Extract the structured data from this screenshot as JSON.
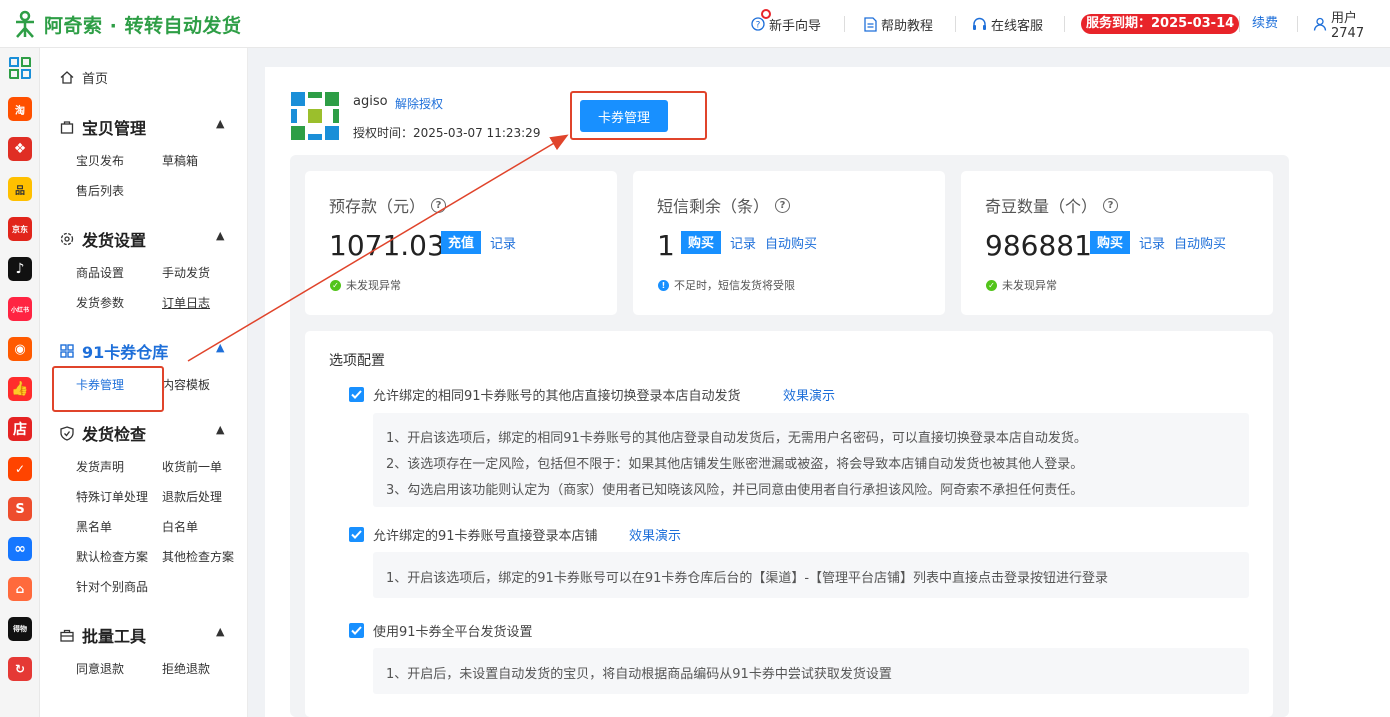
{
  "header": {
    "app_title": "阿奇索 · 转转自动发货",
    "nav": [
      {
        "label": "新手向导"
      },
      {
        "label": "帮助教程"
      },
      {
        "label": "在线客服"
      }
    ],
    "service_expiry": "服务到期：2025-03-14",
    "renew": "续费",
    "user": "用户2747"
  },
  "rail": [
    {
      "icon": "qr-grid-icon",
      "text": ""
    },
    {
      "icon": "taobao-icon",
      "text": "淘",
      "color": "#ff5000"
    },
    {
      "icon": "pinduoduo-icon",
      "text": "",
      "color": "#e02e24"
    },
    {
      "icon": "fupin-icon",
      "text": "品",
      "color": "#ffc000"
    },
    {
      "icon": "jd-icon",
      "text": "京东",
      "color": "#e1251b"
    },
    {
      "icon": "douyin-icon",
      "text": "♪",
      "color": "#111111"
    },
    {
      "icon": "xiaohongshu-icon",
      "text": "小红书",
      "color": "#ff2442"
    },
    {
      "icon": "kuaishou-icon",
      "text": "",
      "color": "#ff5a00"
    },
    {
      "icon": "thumb-icon",
      "text": "",
      "color": "#ff2c2c"
    },
    {
      "icon": "shop-icon",
      "text": "店",
      "color": "#e52323"
    },
    {
      "icon": "bag-icon",
      "text": "",
      "color": "#ff4400"
    },
    {
      "icon": "shopee-icon",
      "text": "S",
      "color": "#ee4d2d"
    },
    {
      "icon": "link-icon",
      "text": "",
      "color": "#1677ff"
    },
    {
      "icon": "store-icon",
      "text": "",
      "color": "#ff6a3c"
    },
    {
      "icon": "dewu-icon",
      "text": "得物",
      "color": "#111111"
    },
    {
      "icon": "zhuanzhuan-icon",
      "text": "",
      "color": "#e53935"
    }
  ],
  "sidebar": {
    "home": "首页",
    "groups": [
      {
        "title": "宝贝管理",
        "items": [
          "宝贝发布",
          "草稿箱",
          "售后列表"
        ]
      },
      {
        "title": "发货设置",
        "items": [
          "商品设置",
          "手动发货",
          "发货参数",
          "订单日志"
        ]
      },
      {
        "title": "91卡券仓库",
        "items": [
          "卡券管理",
          "内容模板"
        ]
      },
      {
        "title": "发货检查",
        "items": [
          "发货声明",
          "收货前一单",
          "特殊订单处理",
          "退款后处理",
          "黑名单",
          "白名单",
          "默认检查方案",
          "其他检查方案",
          "针对个别商品"
        ]
      },
      {
        "title": "批量工具",
        "items": [
          "同意退款",
          "拒绝退款"
        ]
      }
    ]
  },
  "account": {
    "name": "agiso",
    "unbind": "解除授权",
    "auth_time": "授权时间：2025-03-07 11:23:29",
    "card_manage_button": "卡券管理"
  },
  "cards": [
    {
      "title": "预存款（元）",
      "value": "1071.03",
      "button": "充值",
      "links": [
        "记录"
      ],
      "status": "未发现异常",
      "status_type": "ok"
    },
    {
      "title": "短信剩余（条）",
      "value": "1",
      "button": "购买",
      "links": [
        "记录",
        "自动购买"
      ],
      "status": "不足时，短信发货将受限",
      "status_type": "info"
    },
    {
      "title": "奇豆数量（个）",
      "value": "986881",
      "button": "购买",
      "links": [
        "记录",
        "自动购买"
      ],
      "status": "未发现异常",
      "status_type": "ok"
    }
  ],
  "options": {
    "title": "选项配置",
    "items": [
      {
        "label": "允许绑定的相同91卡券账号的其他店直接切换登录本店自动发货",
        "demo": "效果演示",
        "notes": [
          "1、开启该选项后，绑定的相同91卡券账号的其他店登录自动发货后，无需用户名密码，可以直接切换登录本店自动发货。",
          "2、该选项存在一定风险，包括但不限于：如果其他店铺发生账密泄漏或被盗，将会导致本店铺自动发货也被其他人登录。",
          "3、勾选启用该功能则认定为（商家）使用者已知晓该风险，并已同意由使用者自行承担该风险。阿奇索不承担任何责任。"
        ]
      },
      {
        "label": "允许绑定的91卡券账号直接登录本店铺",
        "demo": "效果演示",
        "notes": [
          "1、开启该选项后，绑定的91卡券账号可以在91卡券仓库后台的【渠道】-【管理平台店铺】列表中直接点击登录按钮进行登录"
        ]
      },
      {
        "label": "使用91卡券全平台发货设置",
        "demo": "",
        "notes": [
          "1、开启后，未设置自动发货的宝贝，将自动根据商品编码从91卡券中尝试获取发货设置"
        ]
      }
    ]
  },
  "colors": {
    "accent": "#1890ff",
    "brand": "#2e9e46",
    "alert": "#e8242a",
    "annotation": "#e0442b"
  }
}
